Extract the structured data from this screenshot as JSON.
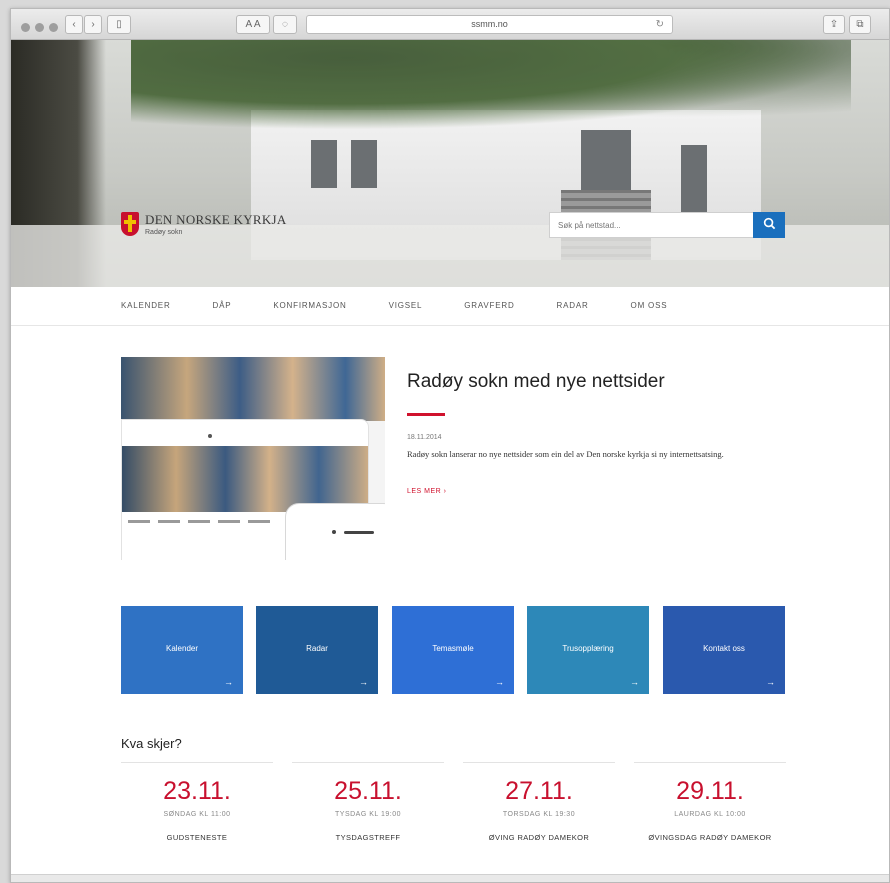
{
  "browser": {
    "url": "ssmm.no",
    "reader_label": "A A",
    "back_glyph": "‹",
    "forward_glyph": "›",
    "sidebar_glyph": "▯",
    "reload_glyph": "↻",
    "share_glyph": "⇪",
    "tabs_glyph": "⧉"
  },
  "header": {
    "logo_title": "DEN NORSKE KYRKJA",
    "logo_subtitle": "Radøy sokn",
    "search_placeholder": "Søk på nettstad...",
    "search_icon": "search-icon"
  },
  "nav": {
    "items": [
      "KALENDER",
      "DÅP",
      "KONFIRMASJON",
      "VIGSEL",
      "GRAVFERD",
      "RADAR",
      "OM OSS"
    ]
  },
  "article": {
    "title": "Radøy sokn med nye nettsider",
    "date": "18.11.2014",
    "text": "Radøy sokn lanserar no nye nettsider som ein del av Den norske kyrkja si ny internettsatsing.",
    "read_more": "LES MER  ›"
  },
  "tiles": [
    {
      "label": "Kalender",
      "arrow": "→",
      "color": "#2f72c4"
    },
    {
      "label": "Radar",
      "arrow": "→",
      "color": "#1f5a96"
    },
    {
      "label": "Temasmøle",
      "arrow": "→",
      "color": "#2e6fd6"
    },
    {
      "label": "Trusopplæring",
      "arrow": "→",
      "color": "#2d88b8"
    },
    {
      "label": "Kontakt oss",
      "arrow": "→",
      "color": "#2a59ae"
    }
  ],
  "events": {
    "heading": "Kva skjer?",
    "items": [
      {
        "date": "23.11.",
        "time": "SØNDAG KL 11:00",
        "name": "GUDSTENESTE"
      },
      {
        "date": "25.11.",
        "time": "TYSDAG KL 19:00",
        "name": "TYSDAGSTREFF"
      },
      {
        "date": "27.11.",
        "time": "TORSDAG KL 19:30",
        "name": "ØVING RADØY DAMEKOR"
      },
      {
        "date": "29.11.",
        "time": "LAURDAG KL 10:00",
        "name": "ØVINGSDAG RADØY DAMEKOR"
      }
    ]
  },
  "colors": {
    "accent_red": "#d0122d",
    "search_blue": "#1a6fbd"
  }
}
